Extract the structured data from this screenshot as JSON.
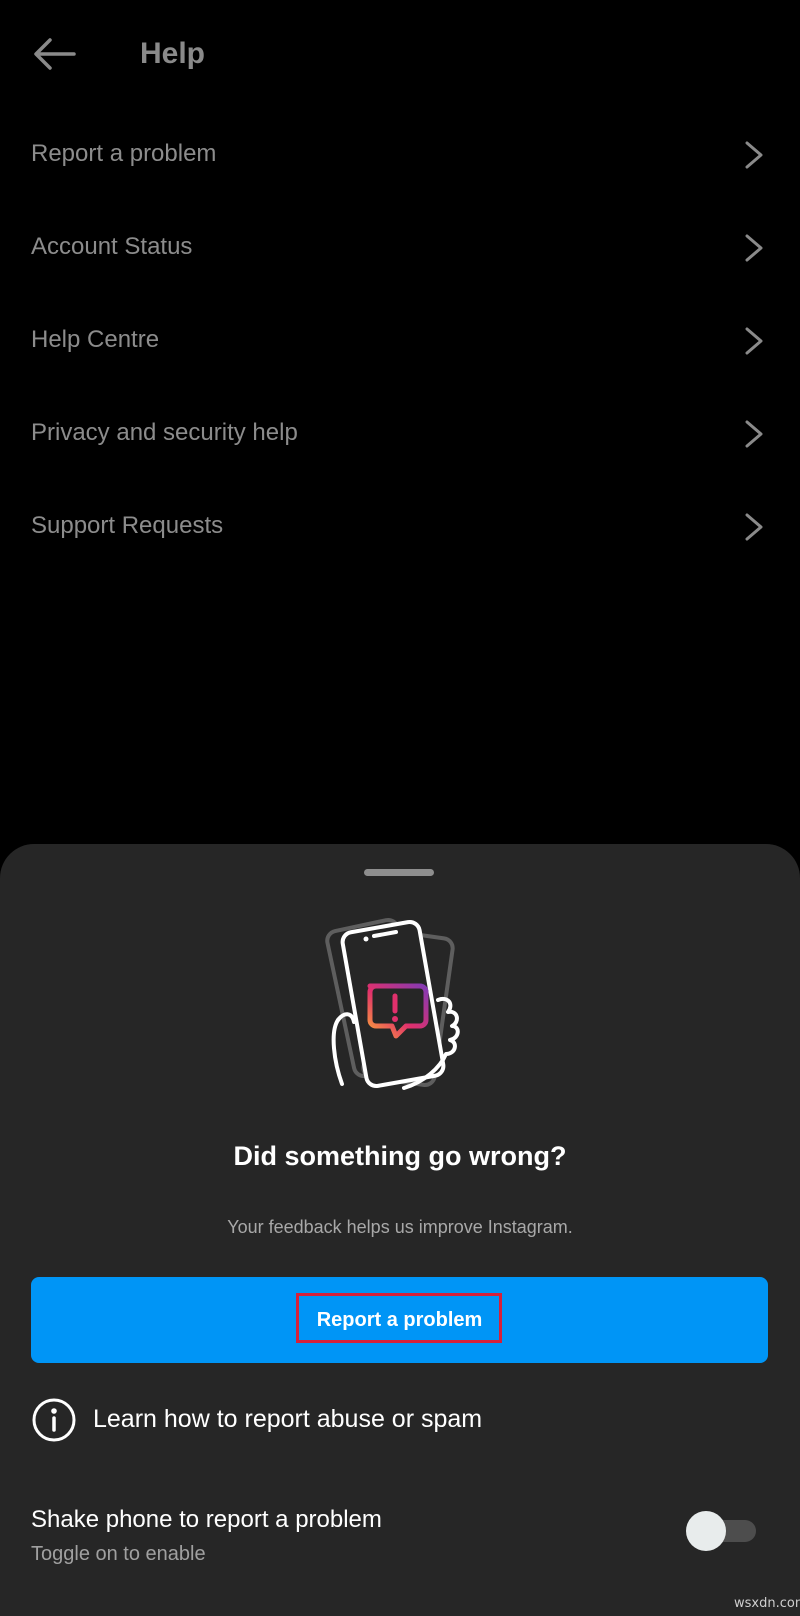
{
  "header": {
    "title": "Help",
    "back_icon": "arrow-left-icon"
  },
  "menu": {
    "items": [
      {
        "label": "Report a problem",
        "icon": "chevron-right-icon"
      },
      {
        "label": "Account Status",
        "icon": "chevron-right-icon"
      },
      {
        "label": "Help Centre",
        "icon": "chevron-right-icon"
      },
      {
        "label": "Privacy and security help",
        "icon": "chevron-right-icon"
      },
      {
        "label": "Support Requests",
        "icon": "chevron-right-icon"
      }
    ]
  },
  "sheet": {
    "title": "Did something go wrong?",
    "subtitle": "Your feedback helps us improve Instagram.",
    "primary_button": "Report a problem",
    "learn_link": "Learn how to report abuse or spam",
    "shake": {
      "title": "Shake phone to report a problem",
      "subtitle": "Toggle on to enable",
      "enabled": false
    }
  },
  "colors": {
    "background": "#000000",
    "sheet": "#262626",
    "accent": "#0095f6",
    "highlight": "#d6203a"
  },
  "watermark": "wsxdn.com"
}
